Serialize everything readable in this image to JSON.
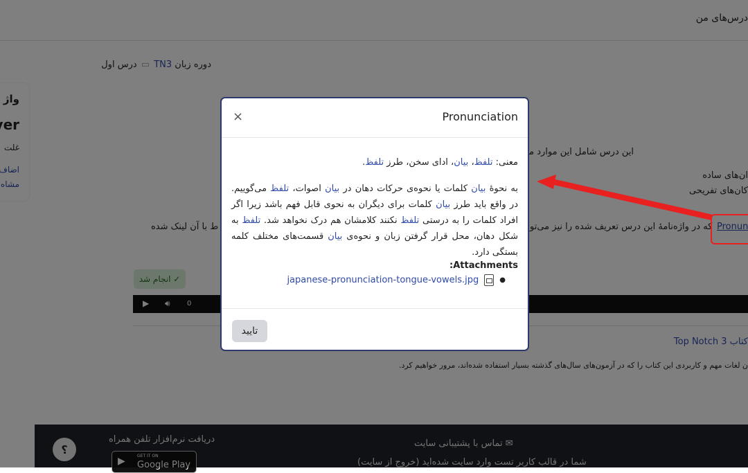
{
  "header": {
    "my_courses": "درس‌های من"
  },
  "breadcrumb": {
    "course_prefix": "دوره زبان",
    "course_link": "TN3",
    "lesson": "درس اول"
  },
  "sidebar_card": {
    "title": "واژ",
    "big": "ver",
    "line1": "غلت",
    "link1": "اضاف",
    "link2": "مشاه"
  },
  "background": {
    "intro": "این درس شامل این موارد می‌باشد: (ماژول برچسب)",
    "item1": "ان‌های ساده",
    "item2": "کان‌های تفریحی",
    "pron_link": "Pronunc",
    "pron_text": "که در واژه‌نامهٔ این درس تعریف شده را نیز می‌تو",
    "linked_text": "ط با آن لینک شده",
    "done_label": "✓ انجام شد",
    "book_title": "کتاب 3 Top Notch",
    "book_desc": "ن لغات مهم و کاربردی این کتاب را که در آزمون‌های سال‌های گذشته بسیار استفاده شده‌اند، مرور خواهیم کرد.",
    "audio_time": "0"
  },
  "footer": {
    "contact": "تماس با پشتیبانی سایت",
    "logged_in": "شما در قالب کاربر تست وارد سایت شده‌اید (خروج از سایت)",
    "mobile_app": "دریافت نرم‌افزار تلفن همراه",
    "get_it_on": "GET IT ON",
    "google_play": "Google Play",
    "help": "؟"
  },
  "modal": {
    "title": "Pronunciation",
    "close": "×",
    "meaning_prefix": "معنی: ",
    "meaning_t1": "تلفظ",
    "meaning_sep1": "، ",
    "meaning_t2": "بیان",
    "meaning_mid": "، ادای سخن، طرز ",
    "meaning_t3": "تلفظ",
    "meaning_end": ".",
    "p1": "به نحوهٔ ",
    "p2": "بیان",
    "p3": " کلمات یا نحوه‌ی حرکات دهان در ",
    "p4": "بیان",
    "p5": " اصوات، ",
    "p6": "تلفظ",
    "p7": " می‌گوییم. در واقع باید طرز ",
    "p8": "بیان",
    "p9": " کلمات برای دیگران به نحوی قابل فهم باشد زیرا اگر افراد کلمات را به درستی ",
    "p10": "تلفظ",
    "p11": " نکنند کلامشان هم درک نخواهد شد. ",
    "p12": "تلفظ",
    "p13": " به شکل دهان، محل قرار گرفتن زبان و نحوه‌ی ",
    "p14": "بیان",
    "p15": " قسمت‌های مختلف کلمه بستگی دارد.",
    "attachments_title": "Attachments:",
    "attachment_file": "japanese-pronunciation-tongue-vowels.jpg",
    "confirm": "تایید"
  },
  "colors": {
    "accent": "#2e4aa8",
    "modal_border": "#2e3a6e",
    "arrow": "#e82020",
    "footer_bg": "#1f2328"
  },
  "icons": [
    "close-icon",
    "file-image-icon",
    "check-icon",
    "play-icon",
    "volume-icon",
    "help-icon",
    "envelope-icon",
    "google-play-icon"
  ]
}
